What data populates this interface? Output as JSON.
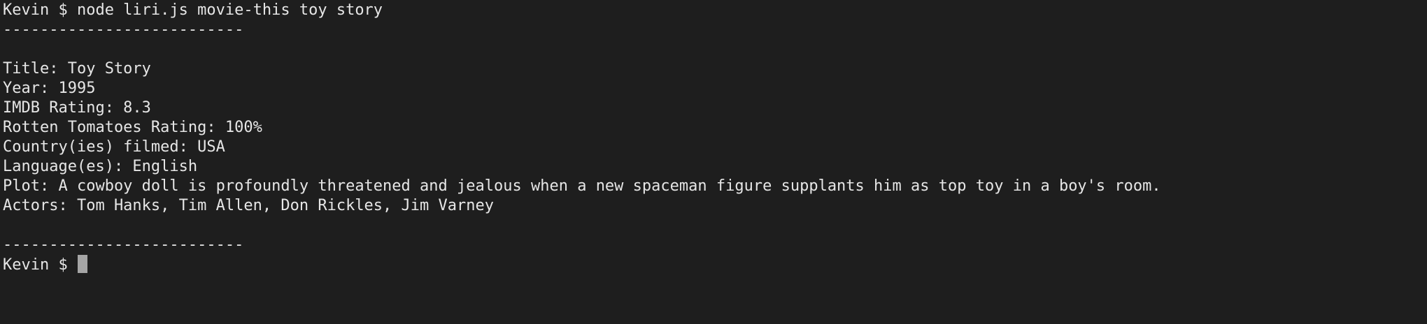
{
  "terminal": {
    "command_line": "Kevin $ node liri.js movie-this toy story",
    "separator_top": "--------------------------",
    "movie": {
      "title": "Title: Toy Story",
      "year": "Year: 1995",
      "imdb": "IMDB Rating: 8.3",
      "rotten": "Rotten Tomatoes Rating: 100%",
      "country": "Country(ies) filmed: USA",
      "language": "Language(es): English",
      "plot": "Plot: A cowboy doll is profoundly threatened and jealous when a new spaceman figure supplants him as top toy in a boy's room.",
      "actors": "Actors: Tom Hanks, Tim Allen, Don Rickles, Jim Varney"
    },
    "separator_bottom": "--------------------------",
    "prompt": "Kevin $ "
  },
  "colors": {
    "background": "#1e1e1e",
    "foreground": "#e6e6e6",
    "cursor": "#a5a5a5"
  }
}
